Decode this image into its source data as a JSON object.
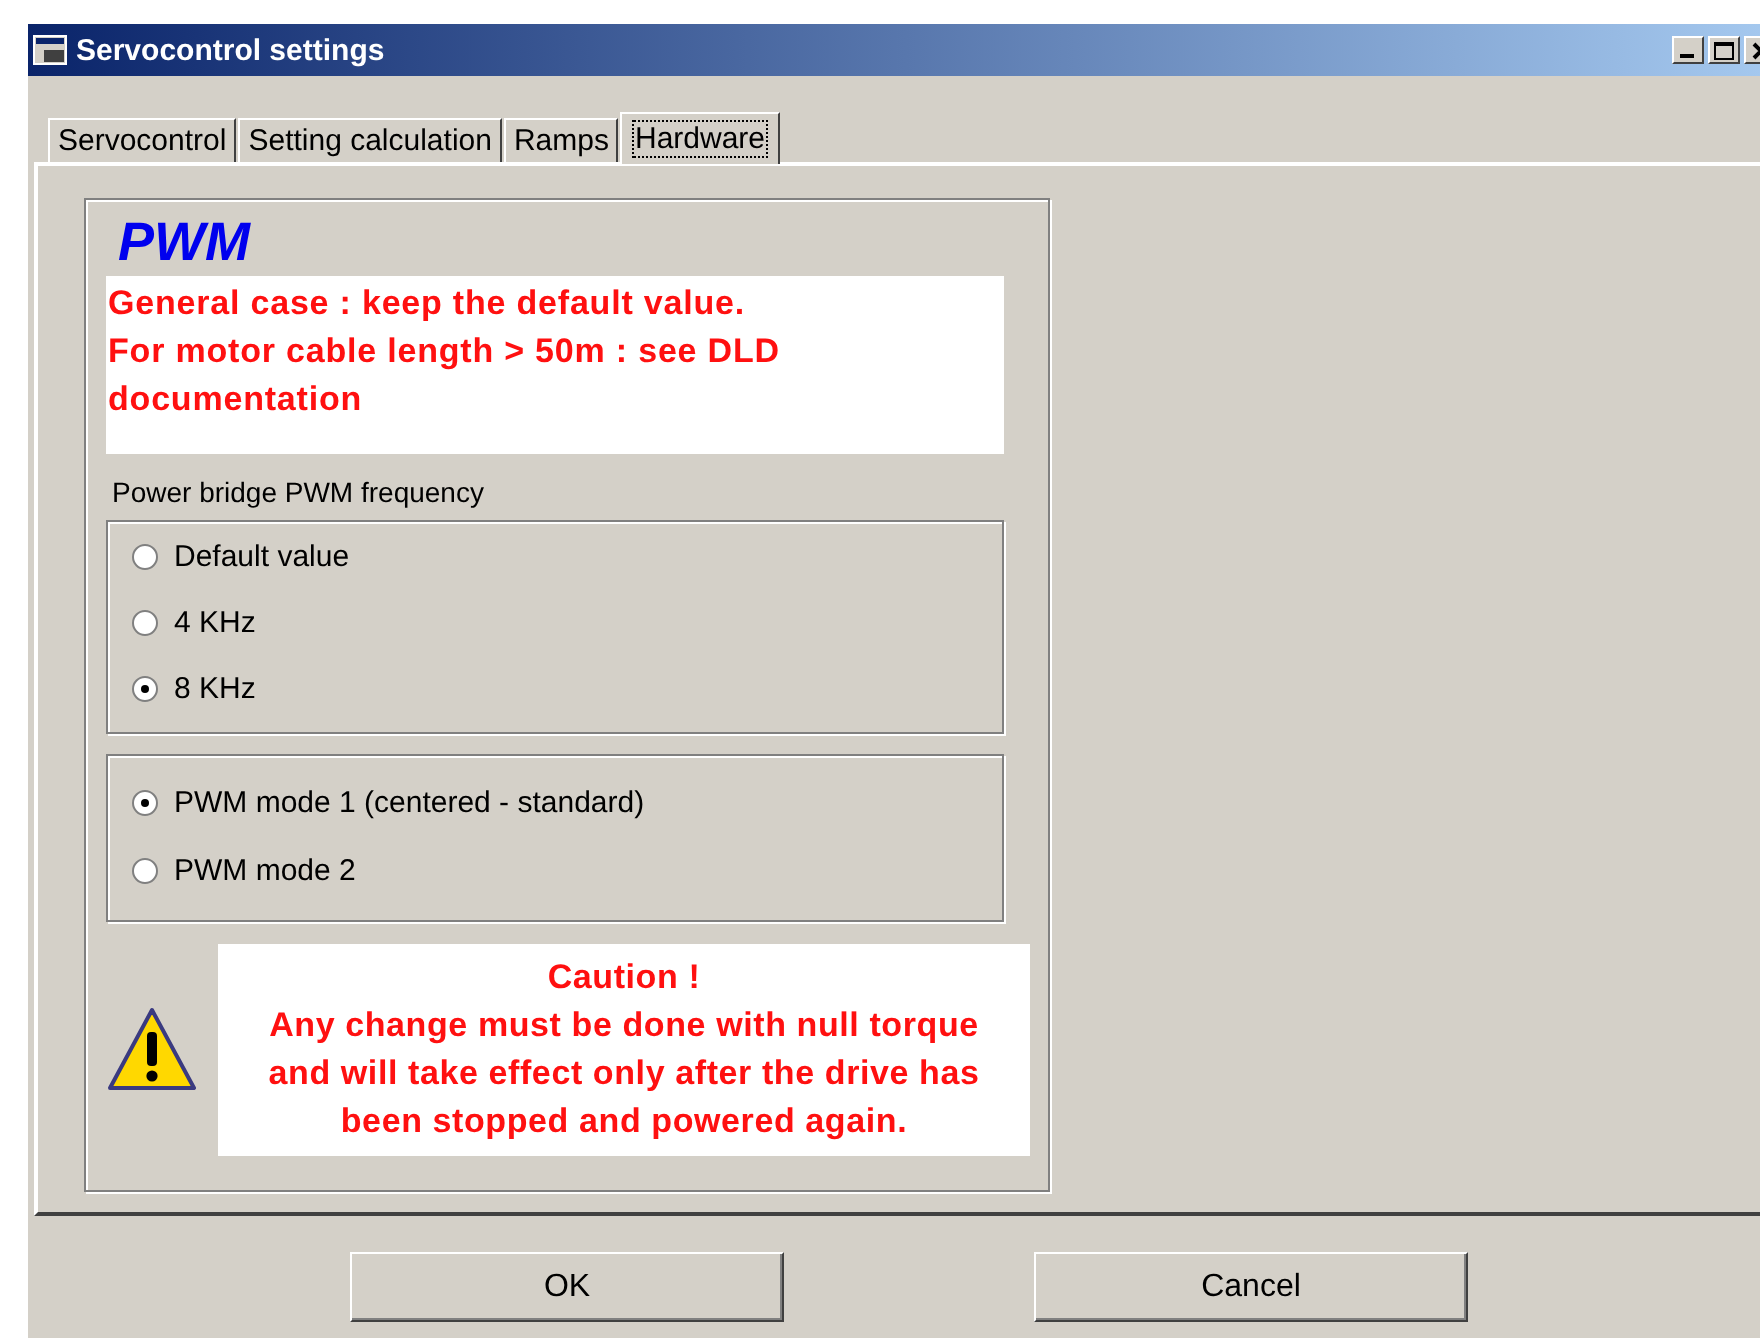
{
  "window": {
    "title": "Servocontrol settings"
  },
  "tabs": [
    {
      "label": "Servocontrol",
      "selected": false
    },
    {
      "label": "Setting calculation",
      "selected": false
    },
    {
      "label": "Ramps",
      "selected": false
    },
    {
      "label": "Hardware",
      "selected": true
    }
  ],
  "section": {
    "title": "PWM",
    "note": "General case : keep the default value.\nFor motor cable length > 50m : see DLD documentation"
  },
  "frequency": {
    "label": "Power bridge PWM frequency",
    "options": [
      {
        "label": "Default value",
        "selected": false
      },
      {
        "label": "4 KHz",
        "selected": false
      },
      {
        "label": "8 KHz",
        "selected": true
      }
    ]
  },
  "mode": {
    "options": [
      {
        "label": "PWM mode 1 (centered - standard)",
        "selected": true
      },
      {
        "label": "PWM mode 2",
        "selected": false
      }
    ]
  },
  "caution": {
    "title": "Caution !",
    "message": "Any change must be done with null torque\nand will take effect only after the drive has\nbeen stopped and powered again."
  },
  "buttons": [
    "OK",
    "Cancel"
  ]
}
